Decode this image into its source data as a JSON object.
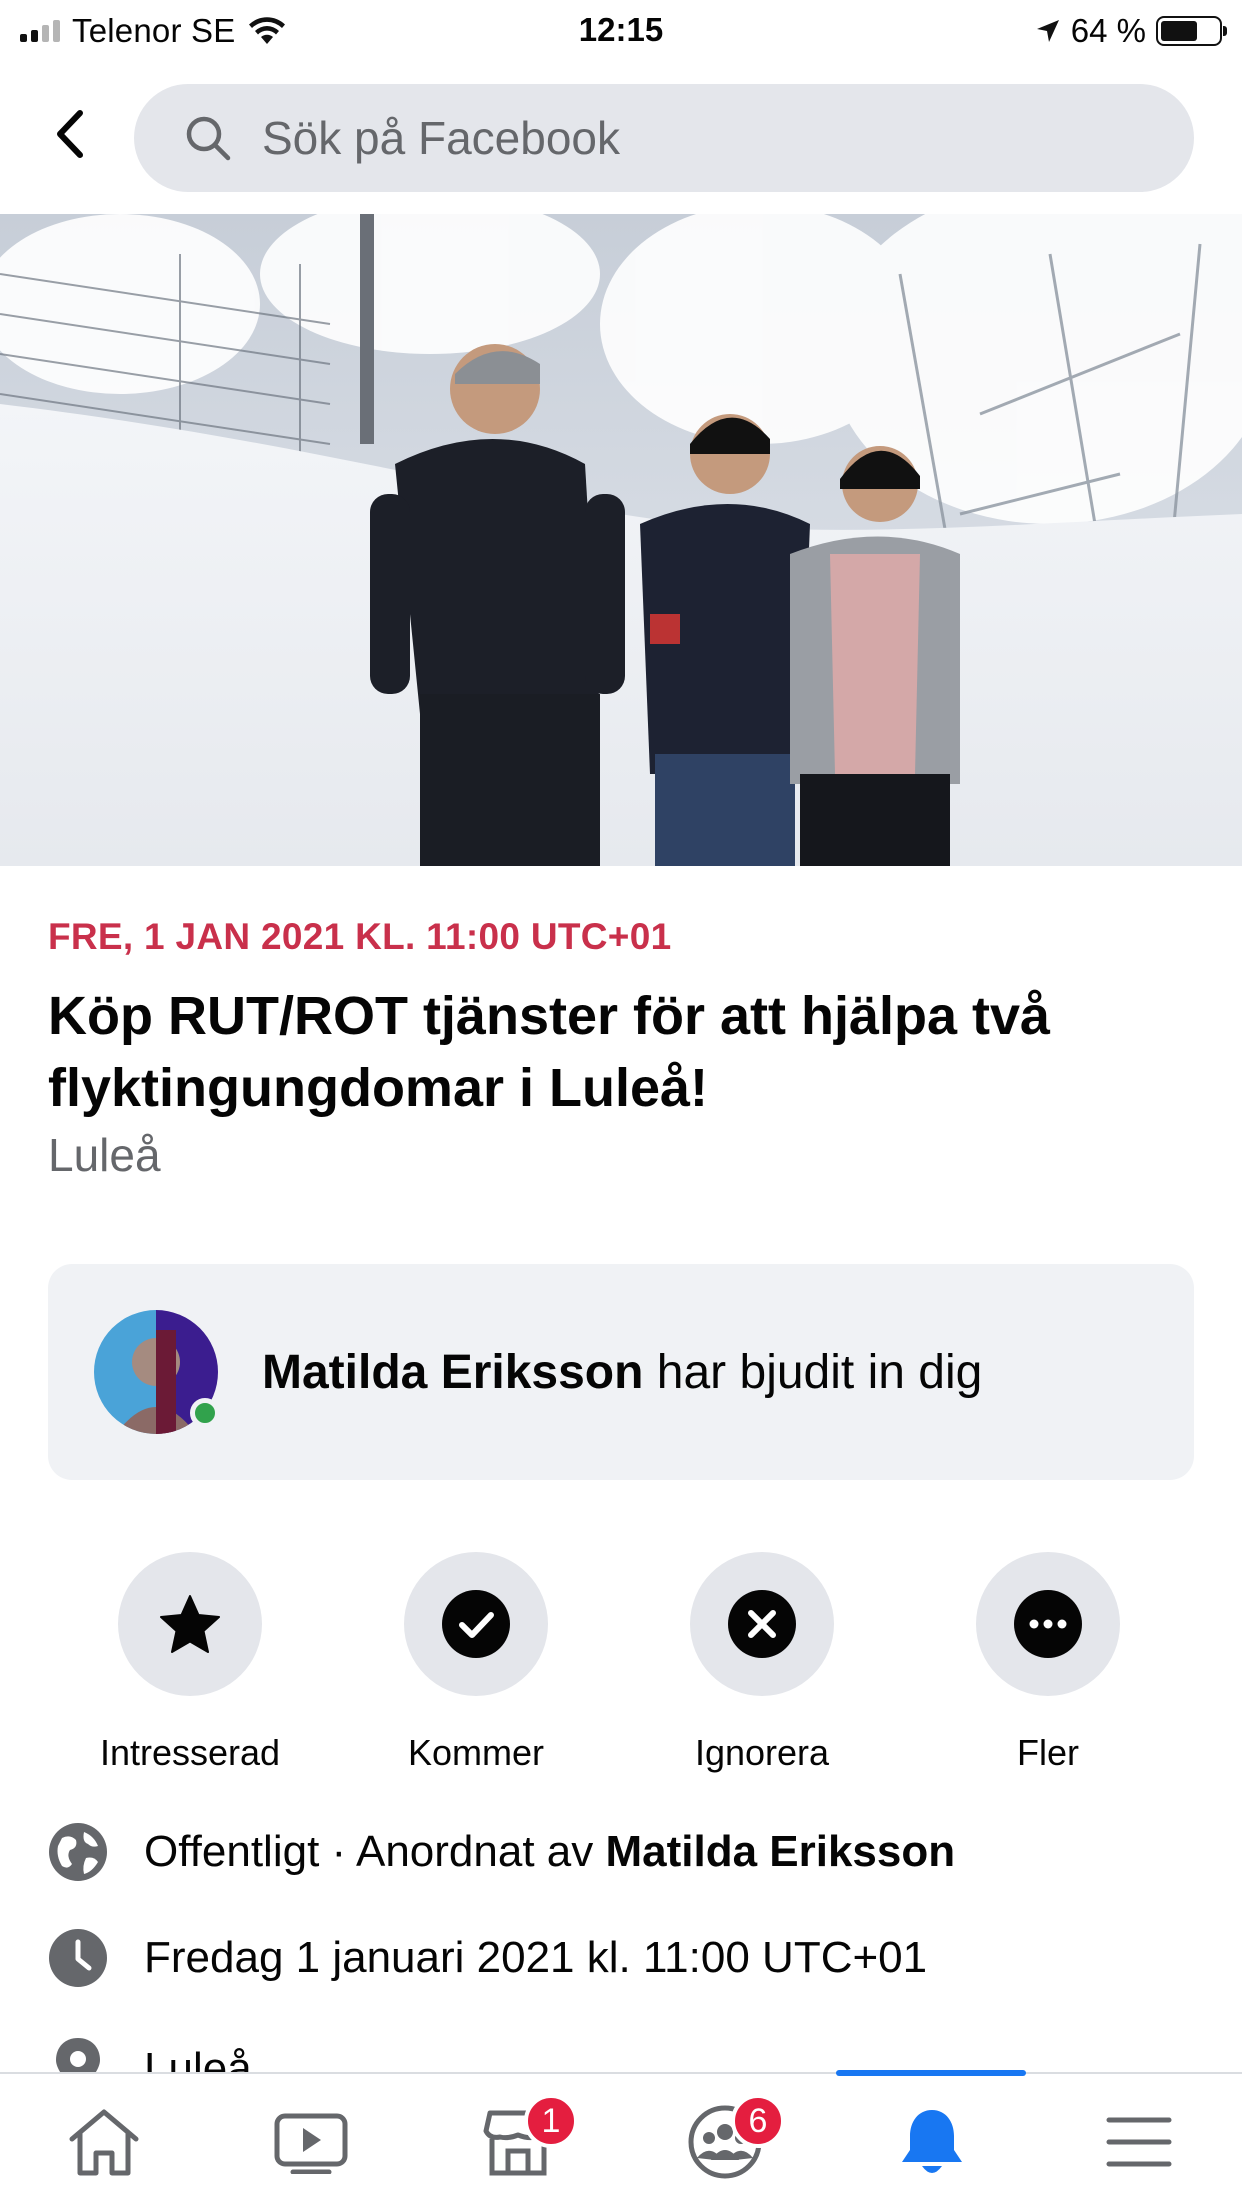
{
  "status_bar": {
    "carrier": "Telenor SE",
    "time": "12:15",
    "battery_percent": "64 %",
    "battery_level": 0.64
  },
  "search": {
    "placeholder": "Sök på Facebook"
  },
  "event": {
    "date": "FRE, 1 JAN 2021 KL. 11:00 UTC+01",
    "title": "Köp RUT/ROT tjänster för att hjälpa två flyktingungdomar i Luleå!",
    "location": "Luleå"
  },
  "invite": {
    "name": "Matilda Eriksson",
    "text": " har bjudit in dig"
  },
  "actions": [
    {
      "label": "Intresserad",
      "icon": "star-icon"
    },
    {
      "label": "Kommer",
      "icon": "check-icon"
    },
    {
      "label": "Ignorera",
      "icon": "close-icon"
    },
    {
      "label": "Fler",
      "icon": "more-icon"
    }
  ],
  "details": {
    "privacy": "Offentligt · Anordnat av ",
    "organizer": "Matilda Eriksson",
    "datetime": "Fredag 1 januari 2021 kl. 11:00 UTC+01",
    "location": "Luleå"
  },
  "bottom_nav": {
    "marketplace_badge": "1",
    "groups_badge": "6",
    "accent_color": "#1877f2"
  }
}
